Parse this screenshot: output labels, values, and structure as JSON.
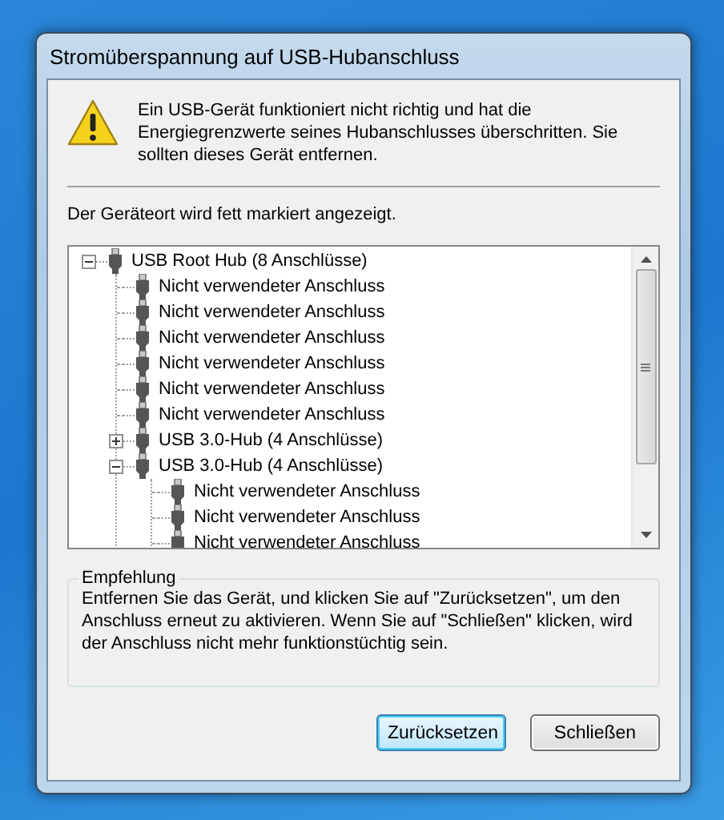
{
  "window": {
    "title": "Stromüberspannung auf USB-Hubanschluss"
  },
  "message": {
    "text": "Ein USB-Gerät funktioniert nicht richtig und hat die Energiegrenzwerte seines Hubanschlusses überschritten. Sie sollten dieses Gerät entfernen."
  },
  "location_hint": "Der Geräteort wird fett markiert angezeigt.",
  "tree": [
    {
      "label": "USB Root Hub (8 Anschlüsse)",
      "expanded": true,
      "children": [
        {
          "label": "Nicht verwendeter Anschluss"
        },
        {
          "label": "Nicht verwendeter Anschluss"
        },
        {
          "label": "Nicht verwendeter Anschluss"
        },
        {
          "label": "Nicht verwendeter Anschluss"
        },
        {
          "label": "Nicht verwendeter Anschluss"
        },
        {
          "label": "Nicht verwendeter Anschluss"
        },
        {
          "label": "USB 3.0-Hub (4 Anschlüsse)",
          "expanded": false
        },
        {
          "label": "USB 3.0-Hub (4 Anschlüsse)",
          "expanded": true,
          "children": [
            {
              "label": "Nicht verwendeter Anschluss"
            },
            {
              "label": "Nicht verwendeter Anschluss"
            },
            {
              "label": "Nicht verwendeter Anschluss"
            }
          ]
        }
      ]
    }
  ],
  "recommendation": {
    "title": "Empfehlung",
    "text": "Entfernen Sie das Gerät, und klicken Sie auf \"Zurücksetzen\", um den Anschluss erneut zu aktivieren. Wenn Sie auf \"Schließen\" klicken, wird der Anschluss nicht mehr funktionstüchtig sein."
  },
  "buttons": [
    {
      "label": "Zurücksetzen",
      "default": true
    },
    {
      "label": "Schließen",
      "default": false
    }
  ]
}
